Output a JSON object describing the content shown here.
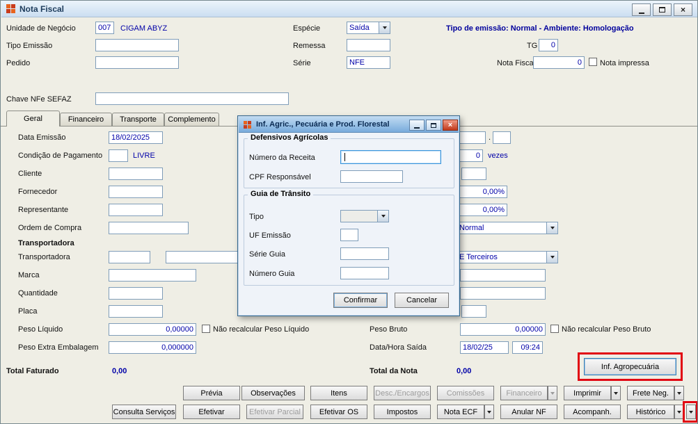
{
  "icons": {
    "close_glyph": "×"
  },
  "window": {
    "title": "Nota Fiscal"
  },
  "header": {
    "unidade_label": "Unidade de Negócio",
    "unidade_value": "007",
    "company": "CIGAM ABYZ",
    "especie_label": "Espécie",
    "especie_value": "Saída",
    "banner": "Tipo de emissão: Normal - Ambiente: Homologação",
    "tipo_emissao_label": "Tipo Emissão",
    "remessa_label": "Remessa",
    "tg_label": "TG",
    "tg_value": "0",
    "pedido_label": "Pedido",
    "serie_label": "Série",
    "serie_value": "NFE",
    "nota_fiscal_label": "Nota Fiscal",
    "nota_fiscal_value": "0",
    "nota_impressa_label": "Nota impressa",
    "chave_label": "Chave NFe SEFAZ"
  },
  "tabs": [
    "Geral",
    "Financeiro",
    "Transporte",
    "Complemento"
  ],
  "geral": {
    "data_emissao_label": "Data Emissão",
    "data_emissao_value": "18/02/2025",
    "cond_pag_label": "Condição de Pagamento",
    "cond_pag_desc": "LIVRE",
    "cliente_label": "Cliente",
    "fornecedor_label": "Fornecedor",
    "representante_label": "Representante",
    "ordem_compra_label": "Ordem de Compra",
    "transportadora_section": "Transportadora",
    "transportadora_label": "Transportadora",
    "marca_label": "Marca",
    "quantidade_label": "Quantidade",
    "placa_label": "Placa",
    "peso_liquido_label": "Peso Líquido",
    "peso_liquido_value": "0,00000",
    "nao_recalc_liquido_label": "Não recalcular Peso Líquido",
    "peso_extra_label": "Peso Extra Embalagem",
    "peso_extra_value": "0,000000",
    "dot": ".",
    "vezes_value": "0",
    "vezes_label": "vezes",
    "perc1_value": "0,00%",
    "perc2_value": "0,00%",
    "frete_tipo_value": "Normal",
    "frete_por_value": "E Terceiros",
    "peso_bruto_label": "Peso Bruto",
    "peso_bruto_value": "0,00000",
    "nao_recalc_bruto_label": "Não recalcular Peso Bruto",
    "data_saida_label": "Data/Hora Saída",
    "data_saida_value": "18/02/25",
    "hora_saida_value": "09:24",
    "total_faturado_label": "Total Faturado",
    "total_faturado_value": "0,00",
    "total_nota_label": "Total da Nota",
    "total_nota_value": "0,00",
    "inf_agro_label": "Inf. Agropecuária"
  },
  "buttons": {
    "row1": [
      "Prévia",
      "Observações",
      "Itens",
      "Desc./Encargos",
      "Comissões",
      "Financeiro",
      "Imprimir",
      "Frete Neg."
    ],
    "row2": [
      "Consulta Serviços",
      "Efetivar",
      "Efetivar Parcial",
      "Efetivar OS",
      "Impostos",
      "Nota ECF",
      "Anular NF",
      "Acompanh.",
      "Histórico"
    ]
  },
  "dialog": {
    "title": "Inf. Agric., Pecuária e Prod. Florestal",
    "group1_title": "Defensivos Agrícolas",
    "numero_receita_label": "Número da Receita",
    "cpf_label": "CPF Responsável",
    "group2_title": "Guia de Trânsito",
    "tipo_label": "Tipo",
    "uf_label": "UF Emissão",
    "serie_guia_label": "Série Guia",
    "numero_guia_label": "Número Guia",
    "confirmar_label": "Confirmar",
    "cancelar_label": "Cancelar"
  }
}
